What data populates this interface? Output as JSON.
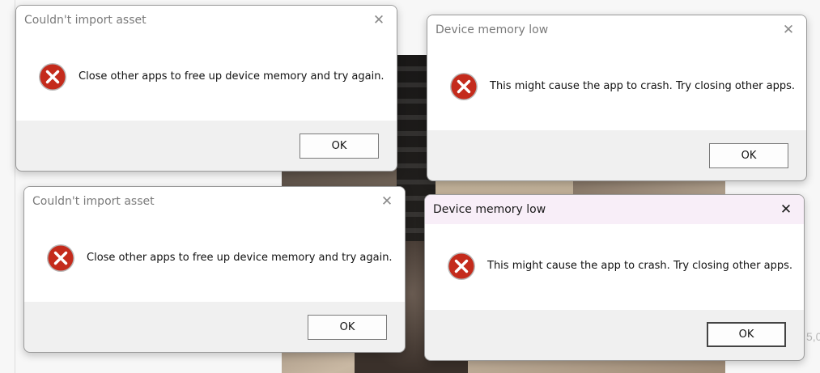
{
  "background": {
    "partial_text": "5,0"
  },
  "dialogs": [
    {
      "title": "Couldn't import asset",
      "message": "Close other apps to free up device memory and try again.",
      "ok_label": "OK",
      "icon": "error-icon",
      "close_glyph": "✕"
    },
    {
      "title": "Device memory low",
      "message": "This might cause the app to crash. Try closing other apps.",
      "ok_label": "OK",
      "icon": "error-icon",
      "close_glyph": "✕"
    },
    {
      "title": "Couldn't import asset",
      "message": "Close other apps to free up device memory and try again.",
      "ok_label": "OK",
      "icon": "error-icon",
      "close_glyph": "✕"
    },
    {
      "title": "Device memory low",
      "message": "This might cause the app to crash. Try closing other apps.",
      "ok_label": "OK",
      "icon": "error-icon",
      "close_glyph": "✕",
      "active": true
    }
  ],
  "colors": {
    "error_red": "#c42b1c",
    "active_titlebar": "#f8eef8",
    "dialog_footer": "#f0f0f0"
  }
}
